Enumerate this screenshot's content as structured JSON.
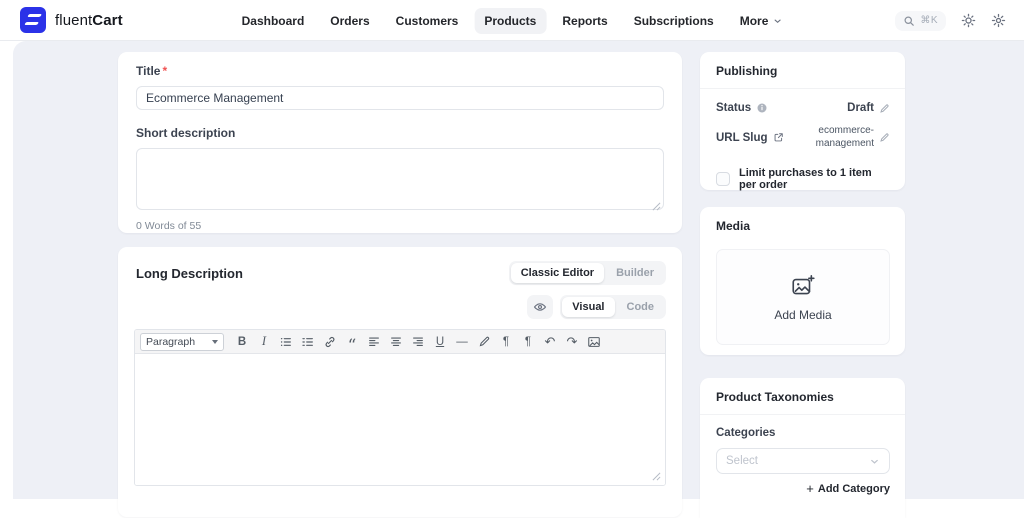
{
  "brand": {
    "regular": "fluent",
    "bold": "Cart"
  },
  "nav": {
    "active_item": "Products",
    "items": [
      {
        "label": "Dashboard"
      },
      {
        "label": "Orders"
      },
      {
        "label": "Customers"
      },
      {
        "label": "Products"
      },
      {
        "label": "Reports"
      },
      {
        "label": "Subscriptions"
      },
      {
        "label": "More"
      }
    ]
  },
  "header_actions": {
    "search_shortcut": "⌘K",
    "icons": [
      "search-icon",
      "theme-sun-icon",
      "settings-gear-icon"
    ]
  },
  "main": {
    "title": {
      "label": "Title",
      "required_mark": "*",
      "value": "Ecommerce Management"
    },
    "short_description": {
      "label": "Short description",
      "value": "",
      "word_count": "0 Words of 55"
    },
    "long_description": {
      "heading": "Long Description",
      "editor_tabs": [
        {
          "label": "Classic Editor",
          "active": true
        },
        {
          "label": "Builder",
          "active": false
        }
      ],
      "mode_tabs": [
        {
          "label": "Visual",
          "active": true
        },
        {
          "label": "Code",
          "active": false
        }
      ],
      "toolbar": {
        "block_format": "Paragraph",
        "glyphs": {
          "bold": "B",
          "italic": "I",
          "underline": "U",
          "blockquote": "“",
          "horizontal_rule": "—",
          "undo": "↶",
          "redo": "↷",
          "ltr": "¶",
          "rtl": "¶"
        },
        "buttons": [
          "format-select",
          "bold",
          "italic",
          "bulleted-list",
          "numbered-list",
          "link",
          "blockquote",
          "align-left",
          "align-center",
          "align-right",
          "underline",
          "horizontal-rule",
          "clear-format",
          "ltr",
          "rtl",
          "undo",
          "redo",
          "insert-image"
        ]
      },
      "content": ""
    }
  },
  "sidebar": {
    "publishing": {
      "title": "Publishing",
      "status_label": "Status",
      "status_value": "Draft",
      "slug_label": "URL Slug",
      "slug_value": "ecommerce-management",
      "limit_checkbox_label": "Limit purchases to 1 item per order",
      "limit_checked": false
    },
    "media": {
      "title": "Media",
      "add_media_label": "Add Media"
    },
    "taxonomies": {
      "title": "Product Taxonomies",
      "categories_label": "Categories",
      "select_placeholder": "Select",
      "add_category_plus": "+",
      "add_category_label": "Add Category"
    }
  },
  "colors": {
    "brand_blue": "#2b32e8",
    "page_bg": "#eef0f6",
    "required_red": "#f05252",
    "active_tab_bg": "#f1f2f5"
  }
}
